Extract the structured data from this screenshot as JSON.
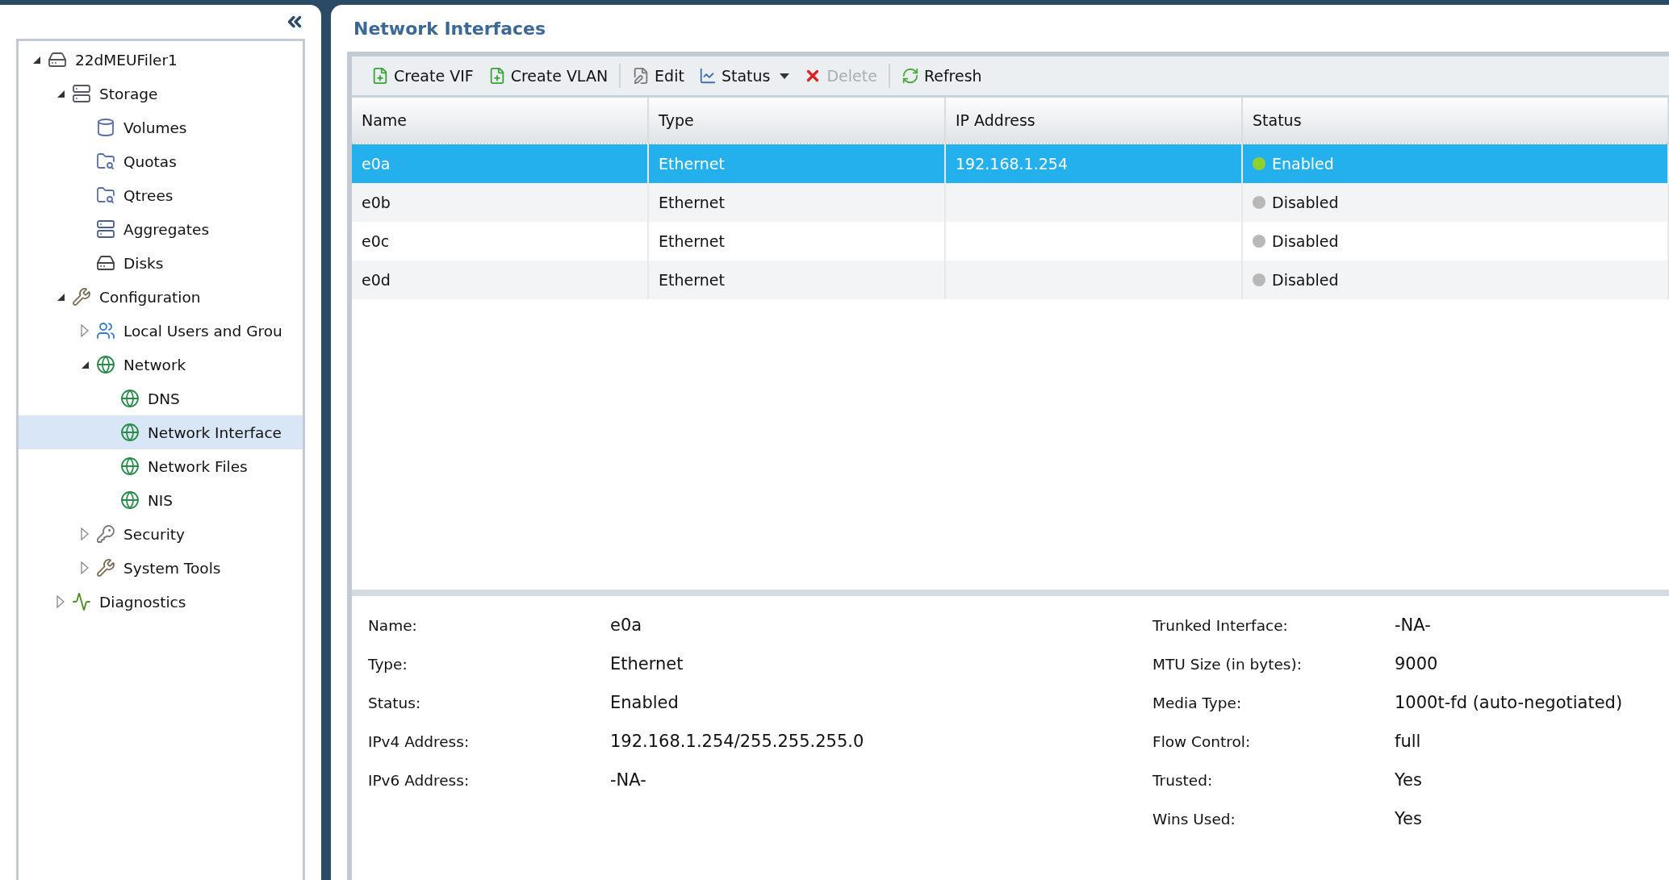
{
  "sidebar": {
    "tree": [
      {
        "label": "22dMEUFiler1",
        "expanded": true,
        "selected": false,
        "children": [
          {
            "label": "Storage",
            "expanded": true,
            "selected": false,
            "children": [
              {
                "label": "Volumes",
                "selected": false
              },
              {
                "label": "Quotas",
                "selected": false
              },
              {
                "label": "Qtrees",
                "selected": false
              },
              {
                "label": "Aggregates",
                "selected": false
              },
              {
                "label": "Disks",
                "selected": false
              }
            ]
          },
          {
            "label": "Configuration",
            "expanded": true,
            "selected": false,
            "children": [
              {
                "label": "Local Users and Grou",
                "expanded": false,
                "selected": false
              },
              {
                "label": "Network",
                "expanded": true,
                "selected": false,
                "children": [
                  {
                    "label": "DNS",
                    "selected": false
                  },
                  {
                    "label": "Network Interface",
                    "selected": true
                  },
                  {
                    "label": "Network Files",
                    "selected": false
                  },
                  {
                    "label": "NIS",
                    "selected": false
                  }
                ]
              },
              {
                "label": "Security",
                "expanded": false,
                "selected": false
              },
              {
                "label": "System Tools",
                "expanded": false,
                "selected": false
              }
            ]
          },
          {
            "label": "Diagnostics",
            "expanded": false,
            "selected": false
          }
        ]
      }
    ]
  },
  "main": {
    "title": "Network Interfaces",
    "toolbar": [
      [
        {
          "label": "Create VIF",
          "disabled": false,
          "dropdown": false
        },
        {
          "label": "Create VLAN",
          "disabled": false,
          "dropdown": false
        }
      ],
      [
        {
          "label": "Edit",
          "disabled": false,
          "dropdown": false
        },
        {
          "label": "Status",
          "disabled": false,
          "dropdown": true
        },
        {
          "label": "Delete",
          "disabled": true,
          "dropdown": false
        }
      ],
      [
        {
          "label": "Refresh",
          "disabled": false,
          "dropdown": false
        }
      ]
    ],
    "table": {
      "columns": [
        "Name",
        "Type",
        "IP Address",
        "Status"
      ],
      "rows": [
        {
          "name": "e0a",
          "type": "Ethernet",
          "ip": "192.168.1.254",
          "status": "Enabled",
          "color": "#8fd12e",
          "selected": true
        },
        {
          "name": "e0b",
          "type": "Ethernet",
          "ip": "",
          "status": "Disabled",
          "color": "#b8b8b8",
          "selected": false
        },
        {
          "name": "e0c",
          "type": "Ethernet",
          "ip": "",
          "status": "Disabled",
          "color": "#b8b8b8",
          "selected": false
        },
        {
          "name": "e0d",
          "type": "Ethernet",
          "ip": "",
          "status": "Disabled",
          "color": "#b8b8b8",
          "selected": false
        }
      ]
    },
    "details": {
      "left": [
        {
          "label": "Name:",
          "value": "e0a"
        },
        {
          "label": "Type:",
          "value": "Ethernet"
        },
        {
          "label": "Status:",
          "value": "Enabled"
        },
        {
          "label": "IPv4 Address:",
          "value": "192.168.1.254/255.255.255.0"
        },
        {
          "label": "IPv6 Address:",
          "value": "-NA-"
        }
      ],
      "right": [
        {
          "label": "Trunked Interface:",
          "value": "-NA-"
        },
        {
          "label": "MTU Size (in bytes):",
          "value": "9000"
        },
        {
          "label": "Media Type:",
          "value": "1000t-fd (auto-negotiated)"
        },
        {
          "label": "Flow Control:",
          "value": "full"
        },
        {
          "label": "Trusted:",
          "value": "Yes"
        },
        {
          "label": "Wins Used:",
          "value": "Yes"
        }
      ]
    }
  }
}
